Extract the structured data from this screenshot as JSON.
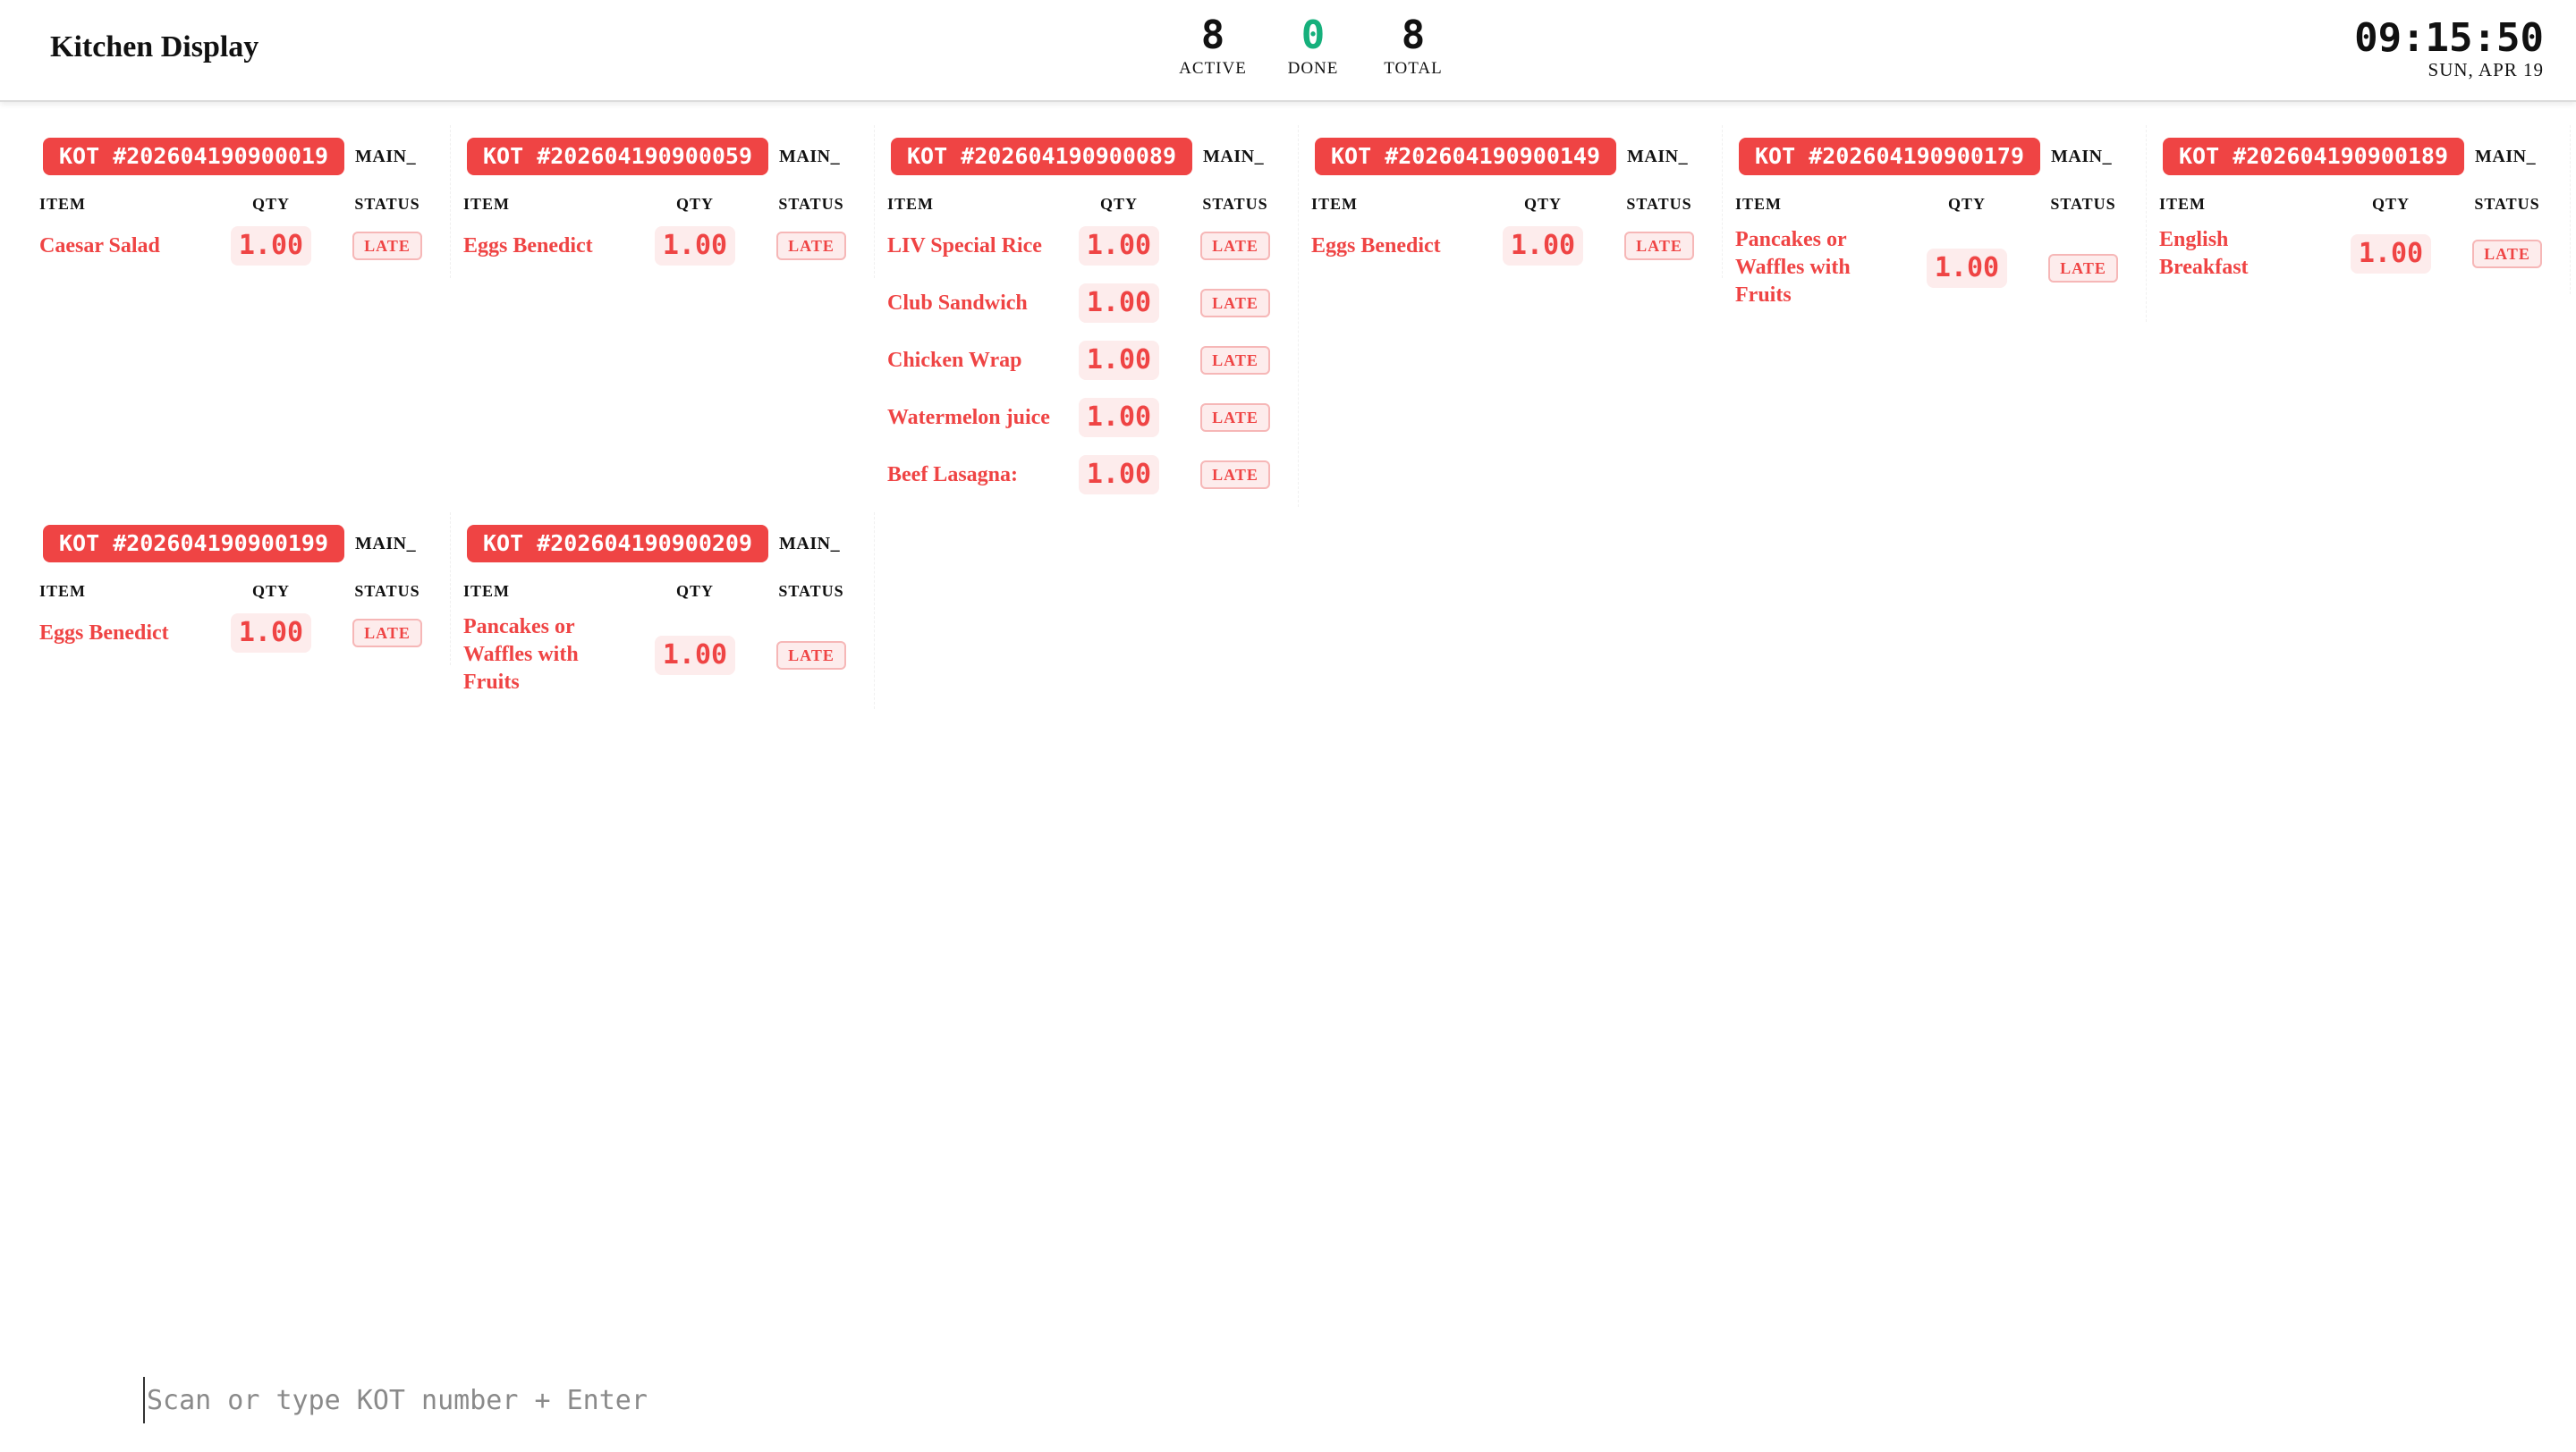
{
  "header": {
    "title": "Kitchen Display",
    "stats": [
      {
        "value": "8",
        "label": "ACTIVE"
      },
      {
        "value": "0",
        "label": "DONE"
      },
      {
        "value": "8",
        "label": "TOTAL"
      }
    ],
    "clock": {
      "time": "09:15:50",
      "date": "SUN, APR 19"
    }
  },
  "columns": {
    "item": "ITEM",
    "qty": "QTY",
    "status": "STATUS"
  },
  "colors": {
    "late_red": "#ef4444",
    "done_green": "#16b07c"
  },
  "tickets": [
    {
      "kot": "KOT #202604190900019",
      "station": "MAIN_",
      "items": [
        {
          "name": "Caesar Salad",
          "qty": "1.00",
          "status": "LATE"
        }
      ]
    },
    {
      "kot": "KOT #202604190900059",
      "station": "MAIN_",
      "items": [
        {
          "name": "Eggs Benedict",
          "qty": "1.00",
          "status": "LATE"
        }
      ]
    },
    {
      "kot": "KOT #202604190900089",
      "station": "MAIN_",
      "items": [
        {
          "name": "LIV Special Rice",
          "qty": "1.00",
          "status": "LATE"
        },
        {
          "name": "Club Sandwich",
          "qty": "1.00",
          "status": "LATE"
        },
        {
          "name": "Chicken Wrap",
          "qty": "1.00",
          "status": "LATE"
        },
        {
          "name": "Watermelon juice",
          "qty": "1.00",
          "status": "LATE"
        },
        {
          "name": "Beef Lasagna:",
          "qty": "1.00",
          "status": "LATE"
        }
      ]
    },
    {
      "kot": "KOT #202604190900149",
      "station": "MAIN_",
      "items": [
        {
          "name": "Eggs Benedict",
          "qty": "1.00",
          "status": "LATE"
        }
      ]
    },
    {
      "kot": "KOT #202604190900179",
      "station": "MAIN_",
      "items": [
        {
          "name": "Pancakes or Waffles with Fruits",
          "qty": "1.00",
          "status": "LATE"
        }
      ]
    },
    {
      "kot": "KOT #202604190900189",
      "station": "MAIN_",
      "items": [
        {
          "name": "English Breakfast",
          "qty": "1.00",
          "status": "LATE"
        }
      ]
    },
    {
      "kot": "KOT #202604190900199",
      "station": "MAIN_",
      "items": [
        {
          "name": "Eggs Benedict",
          "qty": "1.00",
          "status": "LATE"
        }
      ]
    },
    {
      "kot": "KOT #202604190900209",
      "station": "MAIN_",
      "items": [
        {
          "name": "Pancakes or Waffles with Fruits",
          "qty": "1.00",
          "status": "LATE"
        }
      ]
    }
  ],
  "scan": {
    "placeholder": "Scan or type KOT number + Enter",
    "value": ""
  }
}
